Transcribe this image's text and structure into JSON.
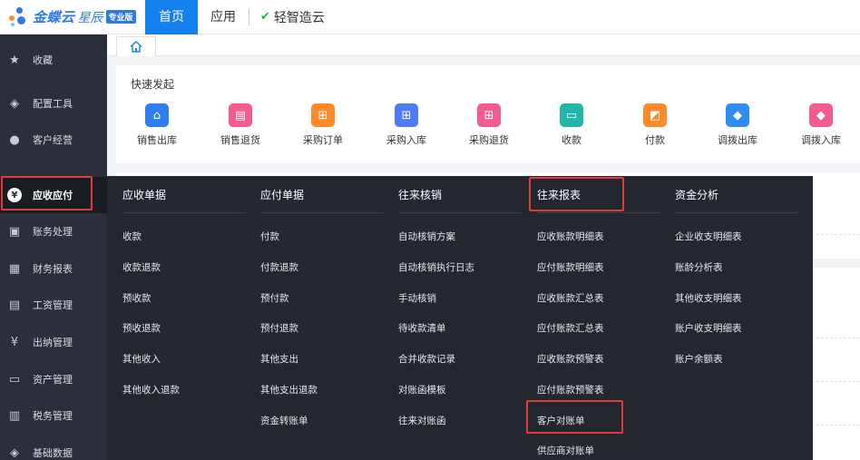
{
  "topbar": {
    "logo_text": "金蝶云",
    "logo_sub": "星辰",
    "logo_badge": "专业版",
    "tabs": [
      "首页",
      "应用"
    ],
    "brand_link": "轻智造云"
  },
  "sidebar": {
    "items": [
      {
        "label": "收藏",
        "icon": "star-icon"
      },
      {
        "label": "配置工具",
        "icon": "layers-icon"
      },
      {
        "label": "客户经营",
        "icon": "person-icon"
      },
      {
        "label": "应收应付",
        "icon": "yen-coin-icon"
      },
      {
        "label": "账务处理",
        "icon": "ledger-icon"
      },
      {
        "label": "财务报表",
        "icon": "report-icon"
      },
      {
        "label": "工资管理",
        "icon": "salary-icon"
      },
      {
        "label": "出纳管理",
        "icon": "cashier-icon"
      },
      {
        "label": "资产管理",
        "icon": "asset-icon"
      },
      {
        "label": "税务管理",
        "icon": "tax-icon"
      },
      {
        "label": "基础数据",
        "icon": "stack-icon"
      }
    ],
    "active_index": 3
  },
  "quick": {
    "title": "快速发起",
    "items": [
      {
        "label": "销售出库",
        "color": "#2f7ff0",
        "icon": "warehouse-out-icon"
      },
      {
        "label": "销售退货",
        "color": "#f45b8f",
        "icon": "return-box-icon"
      },
      {
        "label": "采购订单",
        "color": "#ff8a2a",
        "icon": "cart-icon"
      },
      {
        "label": "采购入库",
        "color": "#4d7cf4",
        "icon": "cart-in-icon"
      },
      {
        "label": "采购退货",
        "color": "#f45b8f",
        "icon": "cart-return-icon"
      },
      {
        "label": "收款",
        "color": "#22b5a8",
        "icon": "receive-icon"
      },
      {
        "label": "付款",
        "color": "#ff8a2a",
        "icon": "pay-icon"
      },
      {
        "label": "调拨出库",
        "color": "#2f8cf0",
        "icon": "transfer-out-icon"
      },
      {
        "label": "调拨入库",
        "color": "#f45b8f",
        "icon": "transfer-in-icon"
      }
    ]
  },
  "mega_menu": {
    "columns": [
      {
        "head": "应收单据",
        "items": [
          "收款",
          "收款退款",
          "预收款",
          "预收退款",
          "其他收入",
          "其他收入退款"
        ]
      },
      {
        "head": "应付单据",
        "items": [
          "付款",
          "付款退款",
          "预付款",
          "预付退款",
          "其他支出",
          "其他支出退款",
          "资金转账单"
        ]
      },
      {
        "head": "往来核销",
        "items": [
          "自动核销方案",
          "自动核销执行日志",
          "手动核销",
          "待收款清单",
          "合并收款记录",
          "对账函模板",
          "往来对账函"
        ]
      },
      {
        "head": "往来报表",
        "items": [
          "应收账款明细表",
          "应付账款明细表",
          "应收账款汇总表",
          "应付账款汇总表",
          "应收账款预警表",
          "应付账款预警表",
          "客户对账单",
          "供应商对账单"
        ]
      },
      {
        "head": "资金分析",
        "items": [
          "企业收支明细表",
          "账龄分析表",
          "其他收支明细表",
          "账户收支明细表",
          "账户余额表"
        ]
      }
    ]
  },
  "colors": {
    "highlight": "#e23b3b",
    "accent": "#1581ee",
    "sidebar_bg": "#2a2f39",
    "menu_bg": "#232730"
  }
}
